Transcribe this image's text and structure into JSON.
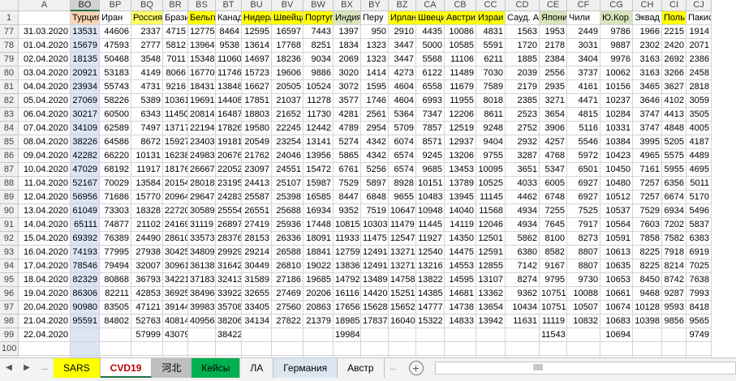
{
  "columns": [
    {
      "id": "rn",
      "label": "",
      "w": 23
    },
    {
      "id": "A",
      "label": "A",
      "w": 64
    },
    {
      "id": "BO",
      "label": "BO",
      "w": 36
    },
    {
      "id": "BP",
      "label": "BP",
      "w": 39
    },
    {
      "id": "BQ",
      "label": "BQ",
      "w": 39
    },
    {
      "id": "BR",
      "label": "BR",
      "w": 31
    },
    {
      "id": "BS",
      "label": "BS",
      "w": 34
    },
    {
      "id": "BT",
      "label": "BT",
      "w": 32
    },
    {
      "id": "BU",
      "label": "BU",
      "w": 37
    },
    {
      "id": "BV",
      "label": "BV",
      "w": 39
    },
    {
      "id": "BW",
      "label": "BW",
      "w": 37
    },
    {
      "id": "BX",
      "label": "BX",
      "w": 34
    },
    {
      "id": "BY",
      "label": "BY",
      "w": 34
    },
    {
      "id": "BZ",
      "label": "BZ",
      "w": 34
    },
    {
      "id": "CA",
      "label": "CA",
      "w": 35
    },
    {
      "id": "CB",
      "label": "CB",
      "w": 39
    },
    {
      "id": "CC",
      "label": "CC",
      "w": 36
    },
    {
      "id": "CD",
      "label": "CD",
      "w": 42
    },
    {
      "id": "CE",
      "label": "CE",
      "w": 34
    },
    {
      "id": "CF",
      "label": "CF",
      "w": 41
    },
    {
      "id": "CG",
      "label": "CG",
      "w": 40
    },
    {
      "id": "CH",
      "label": "CH",
      "w": 36
    },
    {
      "id": "CI",
      "label": "CI",
      "w": 30
    },
    {
      "id": "CJ",
      "label": "CJ",
      "w": 31
    }
  ],
  "header_row": {
    "rownum": "1",
    "cells": [
      {
        "text": "",
        "bg": ""
      },
      {
        "text": "Турция",
        "bg": "#fcd5b4"
      },
      {
        "text": "Иран",
        "bg": ""
      },
      {
        "text": "Россия",
        "bg": "#ffff66"
      },
      {
        "text": "Бразил",
        "bg": ""
      },
      {
        "text": "Бельги",
        "bg": "#ffff00"
      },
      {
        "text": "Канада",
        "bg": ""
      },
      {
        "text": "Нидерл",
        "bg": "#ffff00"
      },
      {
        "text": "Швейца",
        "bg": "#ffff00"
      },
      {
        "text": "Португ",
        "bg": "#ffff00"
      },
      {
        "text": "Индия",
        "bg": "#d8e4bc"
      },
      {
        "text": "Перу",
        "bg": ""
      },
      {
        "text": "Ирлан",
        "bg": "#ffff00"
      },
      {
        "text": "Швеци",
        "bg": "#ffff00"
      },
      {
        "text": "Австри",
        "bg": "#ffff00"
      },
      {
        "text": "Израи",
        "bg": "#ffff00"
      },
      {
        "text": "Сауд. А",
        "bg": ""
      },
      {
        "text": "Япони",
        "bg": "#d8e4bc"
      },
      {
        "text": "Чили",
        "bg": ""
      },
      {
        "text": "Ю.Кор",
        "bg": "#d8e4bc"
      },
      {
        "text": "Эквад",
        "bg": ""
      },
      {
        "text": "Поль",
        "bg": "#ffff00"
      },
      {
        "text": "Пакис",
        "bg": ""
      }
    ]
  },
  "rows": [
    [
      "77",
      "31.03.2020",
      "13531",
      "44606",
      "2337",
      "4715",
      "12775",
      "8464",
      "12595",
      "16597",
      "7443",
      "1397",
      "950",
      "2910",
      "4435",
      "10086",
      "4831",
      "1563",
      "1953",
      "2449",
      "9786",
      "1966",
      "2215",
      "1914"
    ],
    [
      "78",
      "01.04.2020",
      "15679",
      "47593",
      "2777",
      "5812",
      "13964",
      "9538",
      "13614",
      "17768",
      "8251",
      "1834",
      "1323",
      "3447",
      "5000",
      "10585",
      "5591",
      "1720",
      "2178",
      "3031",
      "9887",
      "2302",
      "2420",
      "2071"
    ],
    [
      "79",
      "02.04.2020",
      "18135",
      "50468",
      "3548",
      "7011",
      "15348",
      "11060",
      "14697",
      "18236",
      "9034",
      "2069",
      "1323",
      "3447",
      "5568",
      "11106",
      "6211",
      "1885",
      "2384",
      "3404",
      "9976",
      "3163",
      "2692",
      "2386"
    ],
    [
      "80",
      "03.04.2020",
      "20921",
      "53183",
      "4149",
      "8066",
      "16770",
      "11746",
      "15723",
      "19606",
      "9886",
      "3020",
      "1414",
      "4273",
      "6122",
      "11489",
      "7030",
      "2039",
      "2556",
      "3737",
      "10062",
      "3163",
      "3266",
      "2458"
    ],
    [
      "81",
      "04.04.2020",
      "23934",
      "55743",
      "4731",
      "9216",
      "18431",
      "13848",
      "16627",
      "20505",
      "10524",
      "3072",
      "1595",
      "4604",
      "6558",
      "11679",
      "7589",
      "2179",
      "2935",
      "4161",
      "10156",
      "3465",
      "3627",
      "2818"
    ],
    [
      "82",
      "05.04.2020",
      "27069",
      "58226",
      "5389",
      "10361",
      "19691",
      "14408",
      "17851",
      "21037",
      "11278",
      "3577",
      "1746",
      "4604",
      "6993",
      "11955",
      "8018",
      "2385",
      "3271",
      "4471",
      "10237",
      "3646",
      "4102",
      "3059"
    ],
    [
      "83",
      "06.04.2020",
      "30217",
      "60500",
      "6343",
      "11450",
      "20814",
      "16487",
      "18803",
      "21652",
      "11730",
      "4281",
      "2561",
      "5364",
      "7347",
      "12206",
      "8611",
      "2523",
      "3654",
      "4815",
      "10284",
      "3747",
      "4413",
      "3505"
    ],
    [
      "84",
      "07.04.2020",
      "34109",
      "62589",
      "7497",
      "13717",
      "22194",
      "17826",
      "19580",
      "22245",
      "12442",
      "4789",
      "2954",
      "5709",
      "7857",
      "12519",
      "9248",
      "2752",
      "3906",
      "5116",
      "10331",
      "3747",
      "4848",
      "4005"
    ],
    [
      "85",
      "08.04.2020",
      "38226",
      "64586",
      "8672",
      "15927",
      "23403",
      "19181",
      "20549",
      "23254",
      "13141",
      "5274",
      "4342",
      "6074",
      "8571",
      "12937",
      "9404",
      "2932",
      "4257",
      "5546",
      "10384",
      "3995",
      "5205",
      "4187"
    ],
    [
      "86",
      "09.04.2020",
      "42282",
      "66220",
      "10131",
      "16238",
      "24983",
      "20676",
      "21762",
      "24046",
      "13956",
      "5865",
      "4342",
      "6574",
      "9245",
      "13206",
      "9755",
      "3287",
      "4768",
      "5972",
      "10423",
      "4965",
      "5575",
      "4489"
    ],
    [
      "87",
      "10.04.2020",
      "47029",
      "68192",
      "11917",
      "18176",
      "26667",
      "22052",
      "23097",
      "24551",
      "15472",
      "6761",
      "5256",
      "6574",
      "9685",
      "13453",
      "10095",
      "3651",
      "5347",
      "6501",
      "10450",
      "7161",
      "5955",
      "4695"
    ],
    [
      "88",
      "11.04.2020",
      "52167",
      "70029",
      "13584",
      "20154",
      "28018",
      "23195",
      "24413",
      "25107",
      "15987",
      "7529",
      "5897",
      "8928",
      "10151",
      "13789",
      "10525",
      "4033",
      "6005",
      "6927",
      "10480",
      "7257",
      "6356",
      "5011"
    ],
    [
      "89",
      "12.04.2020",
      "56956",
      "71686",
      "15770",
      "20964",
      "29647",
      "24283",
      "25587",
      "25398",
      "16585",
      "8447",
      "6848",
      "9655",
      "10483",
      "13945",
      "11145",
      "4462",
      "6748",
      "6927",
      "10512",
      "7257",
      "6674",
      "5170"
    ],
    [
      "90",
      "13.04.2020",
      "61049",
      "73303",
      "18328",
      "22720",
      "30589",
      "25554",
      "26551",
      "25688",
      "16934",
      "9352",
      "7519",
      "10647",
      "10948",
      "14040",
      "11568",
      "4934",
      "7255",
      "7525",
      "10537",
      "7529",
      "6934",
      "5496"
    ],
    [
      "91",
      "14.04.2020",
      "65111",
      "74877",
      "21102",
      "24169",
      "31119",
      "26897",
      "27419",
      "25936",
      "17448",
      "10815",
      "10303",
      "11479",
      "11445",
      "14119",
      "12046",
      "4934",
      "7645",
      "7917",
      "10564",
      "7603",
      "7202",
      "5837"
    ],
    [
      "92",
      "15.04.2020",
      "69392",
      "76389",
      "24490",
      "28610",
      "33573",
      "28376",
      "28153",
      "26336",
      "18091",
      "11933",
      "11475",
      "12547",
      "11927",
      "14350",
      "12501",
      "5862",
      "8100",
      "8273",
      "10591",
      "7858",
      "7582",
      "6383"
    ],
    [
      "93",
      "16.04.2020",
      "74193",
      "77995",
      "27938",
      "30425",
      "34809",
      "29929",
      "29214",
      "26588",
      "18841",
      "12759",
      "12491",
      "13271",
      "12540",
      "14475",
      "12591",
      "6380",
      "8582",
      "8807",
      "10613",
      "8225",
      "7918",
      "6919"
    ],
    [
      "94",
      "17.04.2020",
      "78546",
      "79494",
      "32007",
      "30961",
      "36138",
      "31642",
      "30449",
      "26810",
      "19022",
      "13836",
      "12491",
      "13271",
      "13216",
      "14553",
      "12855",
      "7142",
      "9167",
      "8807",
      "10635",
      "8225",
      "8214",
      "7025"
    ],
    [
      "95",
      "18.04.2020",
      "82329",
      "80868",
      "36793",
      "34221",
      "37183",
      "32413",
      "31589",
      "27186",
      "19685",
      "14792",
      "13489",
      "14758",
      "13822",
      "14595",
      "13107",
      "8274",
      "9795",
      "9730",
      "10653",
      "8450",
      "8742",
      "7638"
    ],
    [
      "96",
      "19.04.2020",
      "86306",
      "82211",
      "42853",
      "36925",
      "38496",
      "33922",
      "32655",
      "27469",
      "20206",
      "16116",
      "14420",
      "15251",
      "14385",
      "14681",
      "13362",
      "9362",
      "10751",
      "10088",
      "10661",
      "9468",
      "9287",
      "7993"
    ],
    [
      "97",
      "20.04.2020",
      "90980",
      "83505",
      "47121",
      "39144",
      "39983",
      "35708",
      "33405",
      "27560",
      "20863",
      "17656",
      "15628",
      "15652",
      "14777",
      "14738",
      "13654",
      "10434",
      "10751",
      "10507",
      "10674",
      "10128",
      "9593",
      "8418"
    ],
    [
      "98",
      "21.04.2020",
      "95591",
      "84802",
      "52763",
      "40814",
      "40956",
      "38206",
      "34134",
      "27822",
      "21379",
      "18985",
      "17837",
      "16040",
      "15322",
      "14833",
      "13942",
      "11631",
      "11119",
      "10832",
      "10683",
      "10398",
      "9856",
      "9565"
    ],
    [
      "99",
      "22.04.2020",
      "",
      "",
      "57999",
      "43079",
      "",
      "38422",
      "",
      "",
      "",
      "19984",
      "",
      "",
      "",
      "",
      "",
      "",
      "11543",
      "",
      "10694",
      "",
      "",
      "9749"
    ],
    [
      "100",
      "",
      "",
      "",
      "",
      "",
      "",
      "",
      "",
      "",
      "",
      "",
      "",
      "",
      "",
      "",
      "",
      "",
      "",
      "",
      "",
      "",
      "",
      ""
    ],
    [
      "101",
      "",
      "",
      "",
      "",
      "",
      "",
      "",
      "",
      "",
      "",
      "",
      "",
      "",
      "",
      "",
      "",
      "",
      "",
      "",
      "",
      "",
      "",
      ""
    ]
  ],
  "sheet_tabs": [
    {
      "label": "SARS",
      "bg": "#ffff00",
      "color": "#000",
      "active": false
    },
    {
      "label": "CVD19",
      "bg": "#ffffff",
      "color": "#c00000",
      "active": true
    },
    {
      "label": "河北",
      "bg": "#bfbfbf",
      "color": "#000",
      "active": false
    },
    {
      "label": "Кейсы",
      "bg": "#00b050",
      "color": "#000",
      "active": false
    },
    {
      "label": "ЛА",
      "bg": "#f3f3f3",
      "color": "#000",
      "active": false
    },
    {
      "label": "Германия",
      "bg": "#dce6f1",
      "color": "#000",
      "active": false
    },
    {
      "label": "Австр",
      "bg": "#f3f3f3",
      "color": "#000",
      "active": false
    }
  ],
  "nav": {
    "prev": "◀",
    "next": "▶",
    "more": "...",
    "add": "+",
    "more_right": "..."
  },
  "colors": {
    "selected_col_bg": "#dbe5f4",
    "accent": "#217346"
  }
}
